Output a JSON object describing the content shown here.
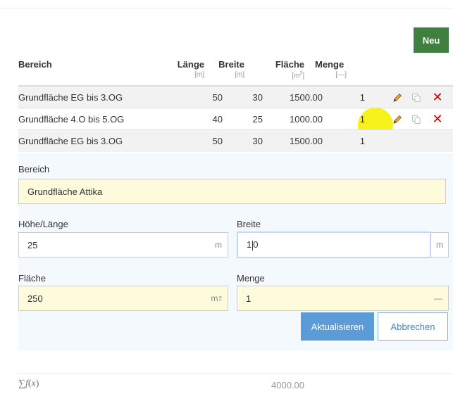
{
  "toolbar": {
    "new_label": "Neu"
  },
  "columns": {
    "bereich": "Bereich",
    "laenge": "Länge",
    "laenge_unit": "[m]",
    "breite": "Breite",
    "breite_unit": "[m]",
    "flaeche": "Fläche",
    "flaeche_unit": "[m",
    "flaeche_unit_sup": "2",
    "flaeche_unit_close": "]",
    "menge": "Menge",
    "menge_unit": "[—]"
  },
  "rows": [
    {
      "name": "Grundfläche EG bis 3.OG",
      "laenge": "50",
      "breite": "30",
      "flaeche": "1500.00",
      "menge": "1"
    },
    {
      "name": "Grundfläche 4.O bis 5.OG",
      "laenge": "40",
      "breite": "25",
      "flaeche": "1000.00",
      "menge": "1"
    },
    {
      "name": "Grundfläche EG bis 3.OG",
      "laenge": "50",
      "breite": "30",
      "flaeche": "1500.00",
      "menge": "1"
    }
  ],
  "form": {
    "bereich_label": "Bereich",
    "bereich_value": "Grundfläche Attika",
    "hoehe_label": "Höhe/Länge",
    "hoehe_value": "25",
    "hoehe_unit": "m",
    "breite_label": "Breite",
    "breite_value_before": "1",
    "breite_value_after": "0",
    "breite_unit": "m",
    "flaeche_label": "Fläche",
    "flaeche_value": "250",
    "flaeche_unit": "m",
    "flaeche_unit_sup": "2",
    "menge_label": "Menge",
    "menge_value": "1",
    "menge_unit": "—",
    "update_label": "Aktualisieren",
    "cancel_label": "Abbrechen"
  },
  "summary": {
    "label_sigma": "∑",
    "label_f": "f",
    "label_x": "x",
    "total": "4000.00"
  },
  "icons": {
    "edit": "pencil-icon",
    "copy": "copy-icon",
    "delete": "close-icon"
  },
  "colors": {
    "new_button": "#3f7f3f",
    "primary": "#5b9bd8",
    "delete": "#cc0000",
    "highlight": "#f7f21c",
    "required_field": "#fdfbdc"
  }
}
